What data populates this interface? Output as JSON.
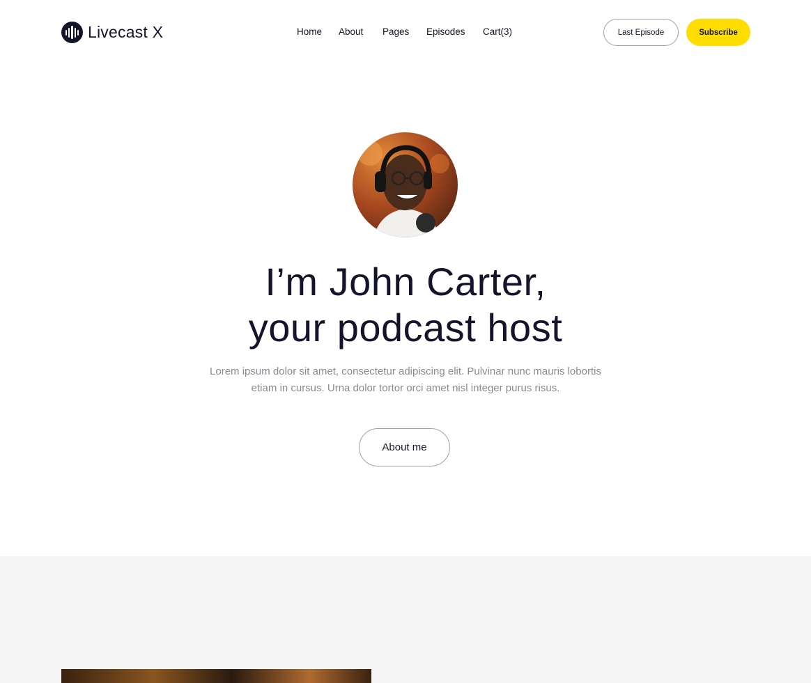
{
  "brand": {
    "name": "Livecast X",
    "logo_icon": "soundwave-icon"
  },
  "nav": {
    "items": [
      {
        "label": "Home"
      },
      {
        "label": "About"
      },
      {
        "label": "Pages"
      },
      {
        "label": "Episodes"
      },
      {
        "label": "Cart(3)"
      }
    ]
  },
  "header": {
    "last_episode_label": "Last Episode",
    "subscribe_label": "Subscribe"
  },
  "hero": {
    "title_line1": "I’m John Carter,",
    "title_line2": "your podcast host",
    "description": "Lorem ipsum dolor sit amet, consectetur adipiscing elit. Pulvinar nunc mauris lobortis etiam in cursus. Urna dolor tortor orci amet nisl integer purus risus.",
    "about_label": "About me"
  },
  "colors": {
    "accent": "#ffdd00",
    "text": "#14142b",
    "muted": "#8a8a95",
    "section_bg": "#f5f5f5"
  }
}
